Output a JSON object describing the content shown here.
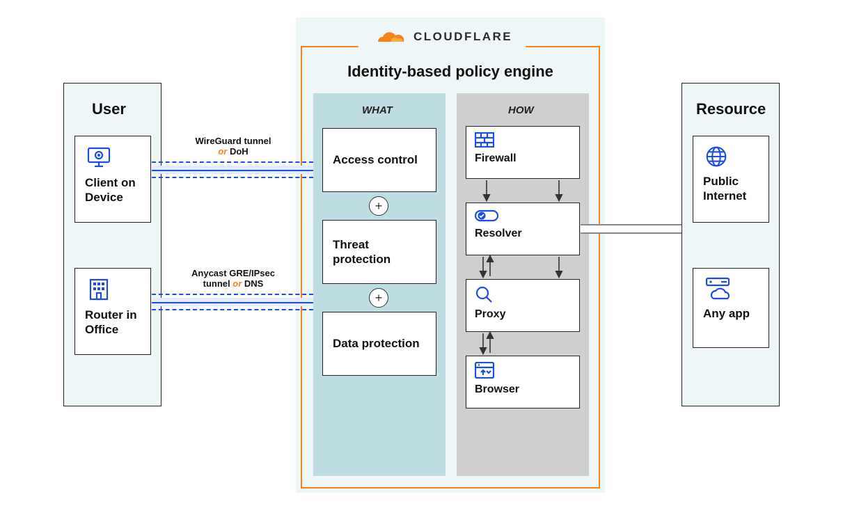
{
  "user": {
    "title": "User",
    "client": "Client on Device",
    "router": "Router in Office"
  },
  "resource": {
    "title": "Resource",
    "internet": "Public Internet",
    "app": "Any app"
  },
  "engine": {
    "brand": "CLOUDFLARE",
    "title": "Identity-based policy engine",
    "what_header": "WHAT",
    "how_header": "HOW",
    "what": {
      "access": "Access control",
      "threat": "Threat protection",
      "data": "Data protection"
    },
    "how": {
      "firewall": "Firewall",
      "resolver": "Resolver",
      "proxy": "Proxy",
      "browser": "Browser"
    }
  },
  "links": {
    "wg_1": "WireGuard tunnel",
    "wg_or": "or",
    "wg_2": " DoH",
    "gre_1": "Anycast GRE/IPsec",
    "gre_2": "tunnel ",
    "gre_or": "or",
    "gre_3": " DNS"
  },
  "symbols": {
    "plus": "+"
  }
}
